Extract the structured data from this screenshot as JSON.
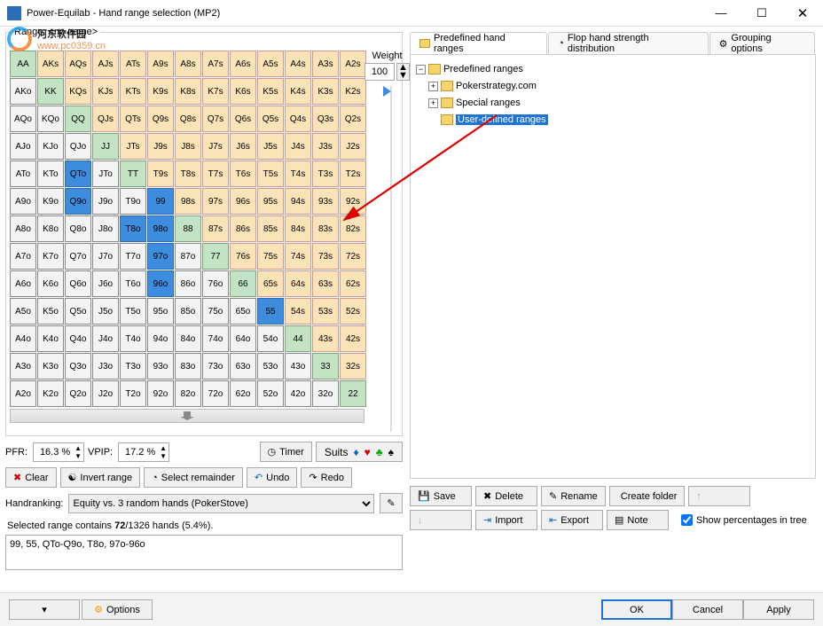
{
  "window": {
    "title": "Power-Equilab - Hand range selection (MP2)",
    "min": "—",
    "max": "☐",
    "close": "✕"
  },
  "watermark": {
    "name": "河东软件园",
    "url": "www.pc0359.cn"
  },
  "range_label": "Range: <no name>",
  "weight": {
    "label": "Weight",
    "value": "100"
  },
  "grid": {
    "rows": [
      [
        "AA",
        "AKs",
        "AQs",
        "AJs",
        "ATs",
        "A9s",
        "A8s",
        "A7s",
        "A6s",
        "A5s",
        "A4s",
        "A3s",
        "A2s"
      ],
      [
        "AKo",
        "KK",
        "KQs",
        "KJs",
        "KTs",
        "K9s",
        "K8s",
        "K7s",
        "K6s",
        "K5s",
        "K4s",
        "K3s",
        "K2s"
      ],
      [
        "AQo",
        "KQo",
        "QQ",
        "QJs",
        "QTs",
        "Q9s",
        "Q8s",
        "Q7s",
        "Q6s",
        "Q5s",
        "Q4s",
        "Q3s",
        "Q2s"
      ],
      [
        "AJo",
        "KJo",
        "QJo",
        "JJ",
        "JTs",
        "J9s",
        "J8s",
        "J7s",
        "J6s",
        "J5s",
        "J4s",
        "J3s",
        "J2s"
      ],
      [
        "ATo",
        "KTo",
        "QTo",
        "JTo",
        "TT",
        "T9s",
        "T8s",
        "T7s",
        "T6s",
        "T5s",
        "T4s",
        "T3s",
        "T2s"
      ],
      [
        "A9o",
        "K9o",
        "Q9o",
        "J9o",
        "T9o",
        "99",
        "98s",
        "97s",
        "96s",
        "95s",
        "94s",
        "93s",
        "92s"
      ],
      [
        "A8o",
        "K8o",
        "Q8o",
        "J8o",
        "T8o",
        "98o",
        "88",
        "87s",
        "86s",
        "85s",
        "84s",
        "83s",
        "82s"
      ],
      [
        "A7o",
        "K7o",
        "Q7o",
        "J7o",
        "T7o",
        "97o",
        "87o",
        "77",
        "76s",
        "75s",
        "74s",
        "73s",
        "72s"
      ],
      [
        "A6o",
        "K6o",
        "Q6o",
        "J6o",
        "T6o",
        "96o",
        "86o",
        "76o",
        "66",
        "65s",
        "64s",
        "63s",
        "62s"
      ],
      [
        "A5o",
        "K5o",
        "Q5o",
        "J5o",
        "T5o",
        "95o",
        "85o",
        "75o",
        "65o",
        "55",
        "54s",
        "53s",
        "52s"
      ],
      [
        "A4o",
        "K4o",
        "Q4o",
        "J4o",
        "T4o",
        "94o",
        "84o",
        "74o",
        "64o",
        "54o",
        "44",
        "43s",
        "42s"
      ],
      [
        "A3o",
        "K3o",
        "Q3o",
        "J3o",
        "T3o",
        "93o",
        "83o",
        "73o",
        "63o",
        "53o",
        "43o",
        "33",
        "32s"
      ],
      [
        "A2o",
        "K2o",
        "Q2o",
        "J2o",
        "T2o",
        "92o",
        "82o",
        "72o",
        "62o",
        "52o",
        "42o",
        "32o",
        "22"
      ]
    ],
    "selected": [
      "QTo",
      "Q9o",
      "T8o",
      "99",
      "97o",
      "96o",
      "98o",
      "55"
    ],
    "soft": [
      "AA",
      "KK",
      "QQ",
      "JJ",
      "TT",
      "88",
      "77",
      "66",
      "44",
      "33",
      "22"
    ]
  },
  "stats": {
    "pfr_l": "PFR:",
    "pfr_v": "16.3 %",
    "vpip_l": "VPIP:",
    "vpip_v": "17.2 %"
  },
  "btns": {
    "timer": "Timer",
    "suits": "Suits",
    "clear": "Clear",
    "invert": "Invert range",
    "remainder": "Select remainder",
    "undo": "Undo",
    "redo": "Redo"
  },
  "handrank": {
    "label": "Handranking:",
    "value": "Equity vs. 3 random hands (PokerStove)"
  },
  "selinfo": {
    "pre": "Selected range contains ",
    "b": "72",
    "post": "/1326 hands (5.4%)."
  },
  "range_text": "99, 55, QTo-Q9o, T8o, 97o-96o",
  "tabs": {
    "t1": "Predefined hand ranges",
    "t2": "Flop hand strength distribution",
    "t3": "Grouping options"
  },
  "tree": {
    "root": "Predefined ranges",
    "n1": "Pokerstrategy.com",
    "n2": "Special ranges",
    "n3": "User-defined ranges"
  },
  "rb": {
    "save": "Save",
    "delete": "Delete",
    "rename": "Rename",
    "create": "Create folder",
    "import": "Import",
    "export": "Export",
    "note": "Note",
    "chk": "Show percentages in tree"
  },
  "bottom": {
    "options": "Options",
    "ok": "OK",
    "cancel": "Cancel",
    "apply": "Apply"
  }
}
